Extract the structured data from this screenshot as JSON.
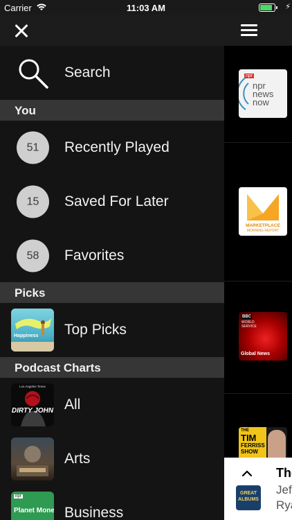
{
  "status_bar": {
    "carrier": "Carrier",
    "time": "11:03 AM"
  },
  "drawer": {
    "search_label": "Search",
    "sections": {
      "you": "You",
      "picks": "Picks",
      "charts": "Podcast Charts"
    },
    "you_items": [
      {
        "count": "51",
        "label": "Recently Played"
      },
      {
        "count": "15",
        "label": "Saved For Later"
      },
      {
        "count": "58",
        "label": "Favorites"
      }
    ],
    "picks_items": [
      {
        "label": "Top Picks",
        "art_text": "Happiness"
      }
    ],
    "chart_items": [
      {
        "label": "All",
        "art_text": "DIRTY JOHN",
        "art_sub": "Los Angeles Times"
      },
      {
        "label": "Arts"
      },
      {
        "label": "Business",
        "art_text": "Planet Money",
        "art_sub": "npr"
      }
    ]
  },
  "main": {
    "podcasts": [
      {
        "name": "npr news now",
        "npr": "npr",
        "line1": "npr",
        "line2": "news",
        "line3": "now"
      },
      {
        "name": "Marketplace Morning Report",
        "line1": "MARKETPLACE",
        "line2": "MORNING REPORT"
      },
      {
        "name": "BBC World Service Global News",
        "line1": "BBC",
        "line2": "WORLD",
        "line3": "SERVICE",
        "line4": "Global News"
      },
      {
        "name": "The Tim Ferriss Show",
        "line1": "THE",
        "line2": "TIM",
        "line3": "FERRISS",
        "line4": "SHOW"
      }
    ]
  },
  "player": {
    "title": "The",
    "subtitle1": "Jef",
    "subtitle2": "Rya",
    "art_line1": "GREAT",
    "art_line2": "ALBUMS"
  }
}
